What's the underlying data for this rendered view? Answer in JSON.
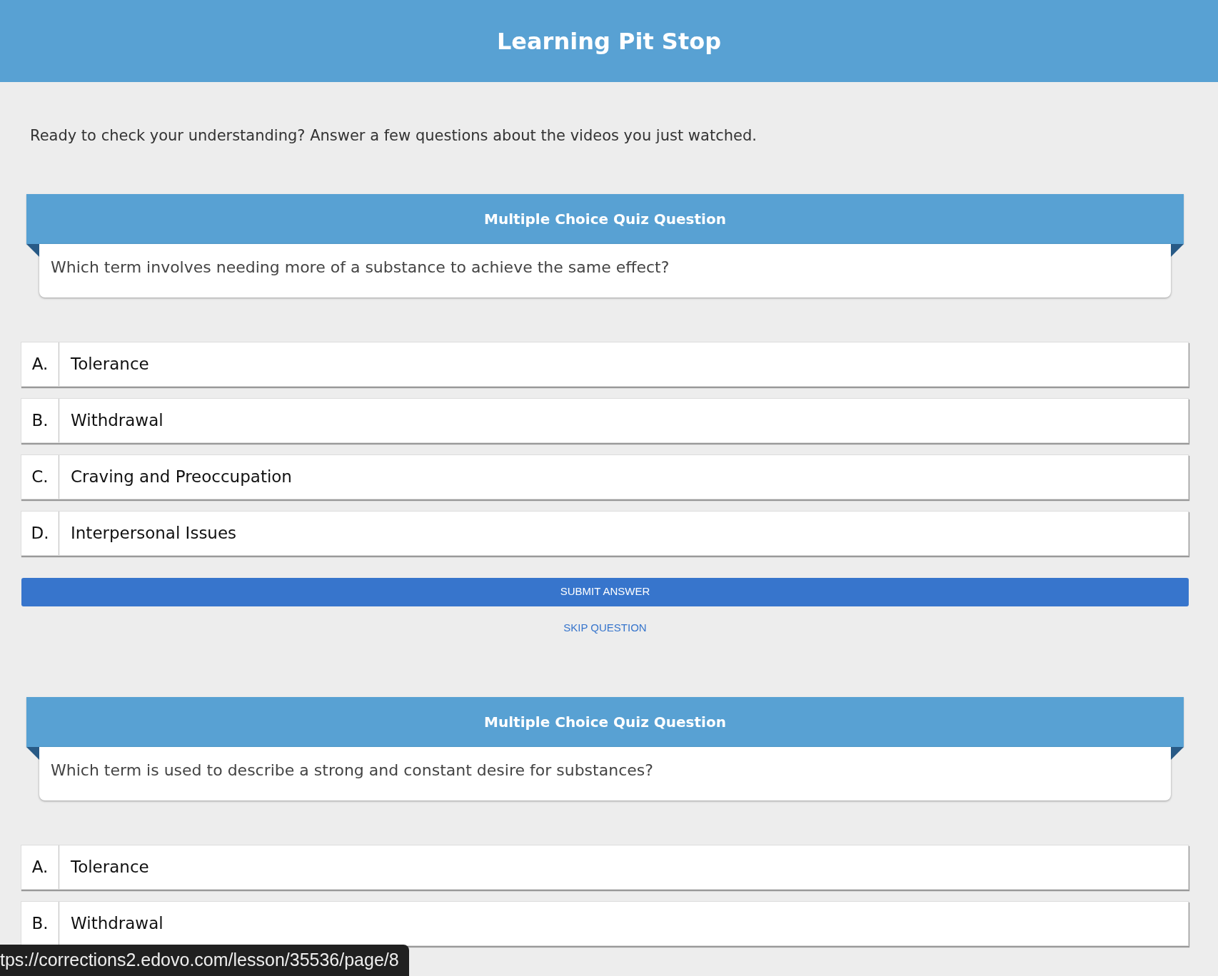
{
  "header": {
    "title": "Learning Pit Stop"
  },
  "intro": "Ready to check your understanding? Answer a few questions about the videos you just watched.",
  "quizzes": [
    {
      "title": "Multiple Choice Quiz Question",
      "question": "Which term involves needing more of a substance to achieve the same effect?",
      "options": [
        {
          "letter": "A.",
          "text": "Tolerance"
        },
        {
          "letter": "B.",
          "text": "Withdrawal"
        },
        {
          "letter": "C.",
          "text": "Craving and Preoccupation"
        },
        {
          "letter": "D.",
          "text": "Interpersonal Issues"
        }
      ],
      "submit_button": "SUBMIT ANSWER",
      "skip_link": "SKIP QUESTION"
    },
    {
      "title": "Multiple Choice Quiz Question",
      "question": "Which term is used to describe a strong and constant desire for substances?",
      "options": [
        {
          "letter": "A.",
          "text": "Tolerance"
        },
        {
          "letter": "B.",
          "text": "Withdrawal"
        }
      ]
    }
  ],
  "status_bar": {
    "url": "tps://corrections2.edovo.com/lesson/35536/page/8"
  }
}
